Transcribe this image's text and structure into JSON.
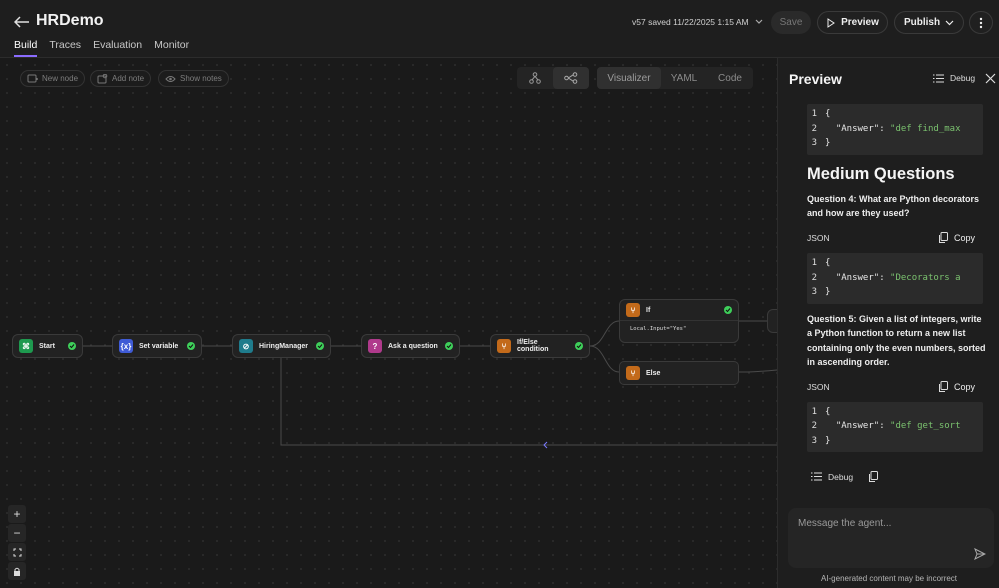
{
  "app": {
    "title": "HRDemo",
    "save_status": "v57 saved 11/22/2025 1:15 AM"
  },
  "tabs": [
    "Build",
    "Traces",
    "Evaluation",
    "Monitor"
  ],
  "header_buttons": {
    "save": "Save",
    "preview": "Preview",
    "publish": "Publish"
  },
  "toolbar": {
    "new_node": "New node",
    "add_note": "Add note",
    "show_notes": "Show notes"
  },
  "view_modes": [
    "Visualizer",
    "YAML",
    "Code"
  ],
  "nodes": {
    "start": "Start",
    "set_variable": "Set variable",
    "hiring_manager": "HiringManager",
    "ask_question": "Ask a question",
    "if_else": "If/Else condition",
    "if": "If",
    "if_condition": "Local.Input=\"Yes\"",
    "else": "Else"
  },
  "colors": {
    "accent": "#8b6cff",
    "check": "#3ecf5a",
    "start": "#1e9a4f",
    "setvar": "#3f5bd6",
    "hiring": "#1f7c8c",
    "ask": "#b03a8c",
    "branch": "#c36a1a",
    "string": "#7bc26f"
  },
  "preview": {
    "title": "Preview",
    "debug_label": "Debug",
    "code1": {
      "lines": [
        "{",
        "\"Answer\": \"def find_max",
        "}"
      ],
      "key": "\"Answer\"",
      "val": "\"def find_max"
    },
    "heading": "Medium Questions",
    "q4": "Question 4: What are Python decorators and how are they used?",
    "json_label": "JSON",
    "copy_label": "Copy",
    "code2_val": "\"Decorators a",
    "q5": "Question 5: Given a list of integers, write a Python function to return a new list containing only the even numbers, sorted in ascending order.",
    "code3_val": "\"def get_sort",
    "msg_debug": "Debug",
    "input_placeholder": "Message the agent...",
    "disclaimer": "AI-generated content may be incorrect"
  }
}
